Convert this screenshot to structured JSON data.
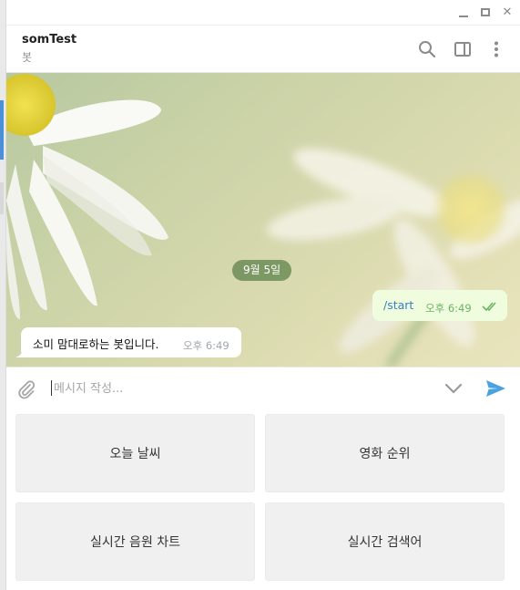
{
  "window": {
    "min_glyph": "",
    "max_glyph": "",
    "close_glyph": "✕"
  },
  "header": {
    "chat_name": "somTest",
    "chat_status": "봇"
  },
  "chat": {
    "date_label": "9월 5일",
    "messages": [
      {
        "direction": "out",
        "text": "/start",
        "time": "오후 6:49",
        "status": "read"
      },
      {
        "direction": "in",
        "text": "소미 맘대로하는 봇입니다.",
        "time": "오후 6:49"
      }
    ]
  },
  "composer": {
    "placeholder": "메시지 작성...",
    "value": ""
  },
  "keyboard": {
    "buttons": [
      {
        "label": "오늘 날씨"
      },
      {
        "label": "영화 순위"
      },
      {
        "label": "실시간 음원 차트"
      },
      {
        "label": "실시간 검색어"
      }
    ]
  },
  "colors": {
    "accent": "#4a8fd8",
    "outgoing_bubble": "#effdde",
    "outgoing_time": "#6db365",
    "link_text": "#3a7fc1",
    "send_icon": "#4aa3e0"
  }
}
